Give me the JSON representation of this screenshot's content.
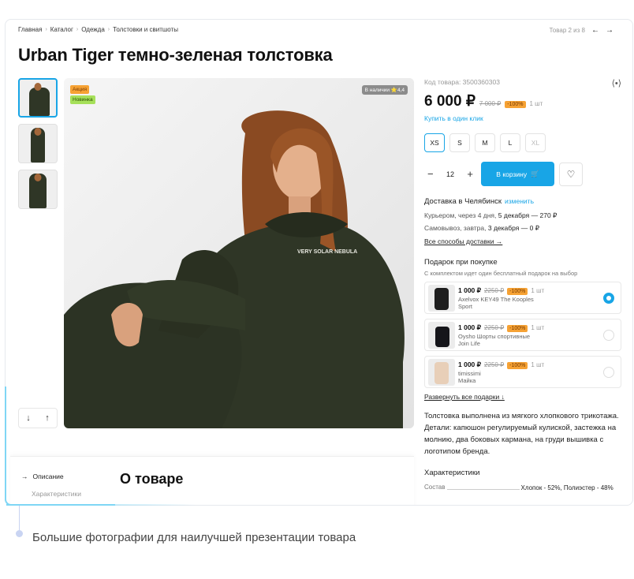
{
  "breadcrumb": [
    "Главная",
    "Каталог",
    "Одежда",
    "Толстовки и свитшоты"
  ],
  "pager": {
    "label": "Товар 2 из 8"
  },
  "product": {
    "title": "Urban Tiger темно-зеленая толстовка",
    "code": "Код товара: 3500360303",
    "price": "6 000 ₽",
    "old_price": "7 000 ₽",
    "discount": "-100%",
    "qty_note": "1 шт",
    "oneclick": "Купить в один клик",
    "badges": {
      "sale": "Акция",
      "new": "Новинка"
    },
    "stock": "В наличии  ⭐4,4",
    "sizes": [
      {
        "label": "XS",
        "state": "selected"
      },
      {
        "label": "S",
        "state": "normal"
      },
      {
        "label": "M",
        "state": "normal"
      },
      {
        "label": "L",
        "state": "normal"
      },
      {
        "label": "XL",
        "state": "disabled"
      }
    ],
    "quantity": "12",
    "cart_label": "В корзину"
  },
  "delivery": {
    "title": "Доставка в Челябинск",
    "change": "изменить",
    "courier_prefix": "Курьером, через 4 дня, ",
    "courier_value": "5 декабря — 270 ₽",
    "pickup_prefix": "Самовывоз, завтра, ",
    "pickup_value": "3 декабря — 0 ₽",
    "all_link": "Все способы доставки →"
  },
  "gifts": {
    "title": "Подарок при покупке",
    "subtitle": "С комплектом идет один бесплатный подарок на выбор",
    "items": [
      {
        "price": "1 000 ₽",
        "old": "2250 ₽",
        "disc": "-100%",
        "qty": "1 шт",
        "name1": "Axelvox KEY49 The Kooples",
        "name2": "Sport",
        "selected": true
      },
      {
        "price": "1 000 ₽",
        "old": "2250 ₽",
        "disc": "-100%",
        "qty": "1 шт",
        "name1": "Oysho Шорты спортивные",
        "name2": "Join Life",
        "selected": false
      },
      {
        "price": "1 000 ₽",
        "old": "2250 ₽",
        "disc": "-100%",
        "qty": "1 шт",
        "name1": "timissimi",
        "name2": "Майка",
        "selected": false
      }
    ],
    "expand": "Развернуть все подарки ↓"
  },
  "description": "Толстовка выполнена из мягкого хлопкового трикотажа. Детали: капюшон регулируемый кулиской, застежка на молнию, два боковых кармана, на груди вышивка с логотипом бренда.",
  "characteristics": {
    "title": "Характеристики",
    "rows": [
      {
        "key": "Состав",
        "value": "Хлопок - 52%, Полиэстер - 48%"
      }
    ]
  },
  "side_nav": {
    "active": "Описание",
    "sub": "Характеристики"
  },
  "about_title": "О товаре",
  "caption": "Большие фотографии для наилучшей презентации товара",
  "colors": {
    "accent": "#18a5e6",
    "sale": "#f6a234",
    "new": "#a6e05a",
    "garment": "#2f3626"
  }
}
